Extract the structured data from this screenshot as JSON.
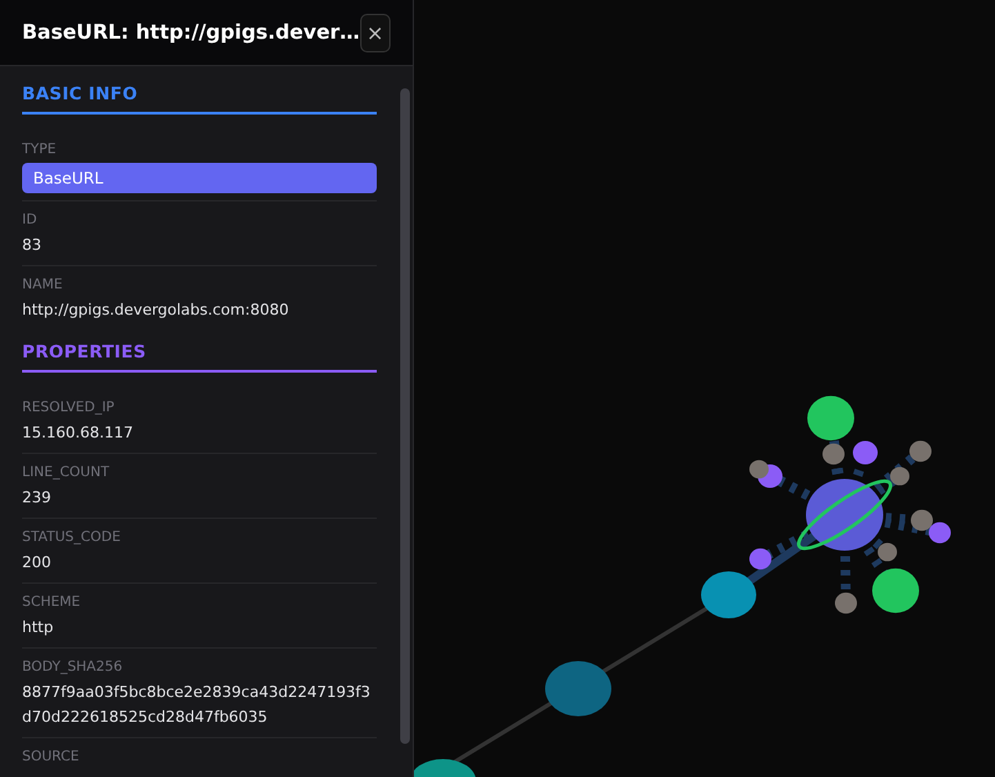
{
  "panel": {
    "title": "BaseURL: http://gpigs.dever…",
    "close_label": "×"
  },
  "sections": [
    {
      "title": "BASIC INFO",
      "color": "#3b82f6",
      "fields": [
        {
          "label": "TYPE",
          "value": "BaseURL",
          "kind": "badge"
        },
        {
          "label": "ID",
          "value": "83",
          "kind": "text"
        },
        {
          "label": "NAME",
          "value": "http://gpigs.devergolabs.com:8080",
          "kind": "text"
        }
      ]
    },
    {
      "title": "PROPERTIES",
      "color": "#8b5cf6",
      "fields": [
        {
          "label": "RESOLVED_IP",
          "value": "15.160.68.117",
          "kind": "text"
        },
        {
          "label": "LINE_COUNT",
          "value": "239",
          "kind": "text"
        },
        {
          "label": "STATUS_CODE",
          "value": "200",
          "kind": "text"
        },
        {
          "label": "SCHEME",
          "value": "http",
          "kind": "text"
        },
        {
          "label": "BODY_SHA256",
          "value": "8877f9aa03f5bc8bce2e2839ca43d2247193f3d70d222618525cd28d47fb6035",
          "kind": "text"
        },
        {
          "label": "SOURCE",
          "kind": "text"
        }
      ]
    }
  ]
}
